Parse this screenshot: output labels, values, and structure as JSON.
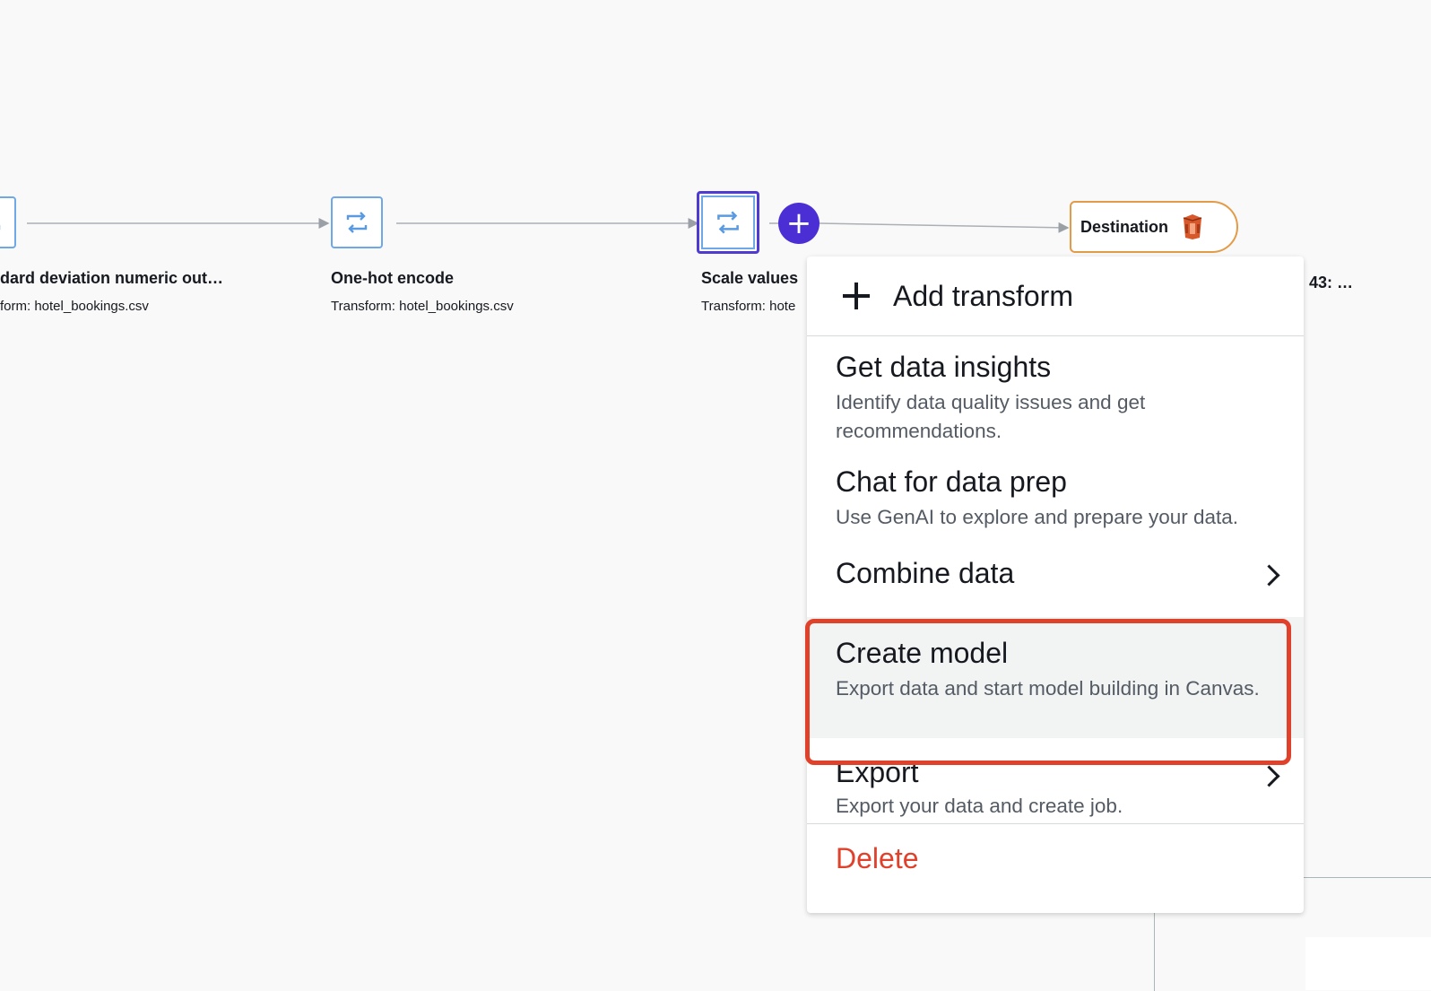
{
  "nodes": [
    {
      "title": "dard deviation numeric out…",
      "subtitle": "form: hotel_bookings.csv"
    },
    {
      "title": "One-hot encode",
      "subtitle": "Transform: hotel_bookings.csv"
    },
    {
      "title": "Scale values",
      "subtitle": "Transform: hote"
    }
  ],
  "destination": {
    "label": "Destination",
    "icon": "s3-bucket-icon"
  },
  "clipped_label": "43: …",
  "add_button": {
    "icon": "plus-icon"
  },
  "menu": {
    "add_transform": "Add transform",
    "items": [
      {
        "title": "Get data insights",
        "desc": "Identify data quality issues and get recommendations."
      },
      {
        "title": "Chat for data prep",
        "desc": "Use GenAI to explore and prepare your data."
      },
      {
        "title": "Combine data",
        "desc": ""
      },
      {
        "title": "Create model",
        "desc": "Export data and start model building in Canvas."
      },
      {
        "title": "Export",
        "desc": "Export your data and create job."
      }
    ],
    "delete": "Delete"
  },
  "colors": {
    "accent": "#4b2fd4",
    "highlight": "#e0412a",
    "delete": "#e0412a",
    "destination_border": "#e39b48",
    "node_border": "#6ea8e6"
  }
}
